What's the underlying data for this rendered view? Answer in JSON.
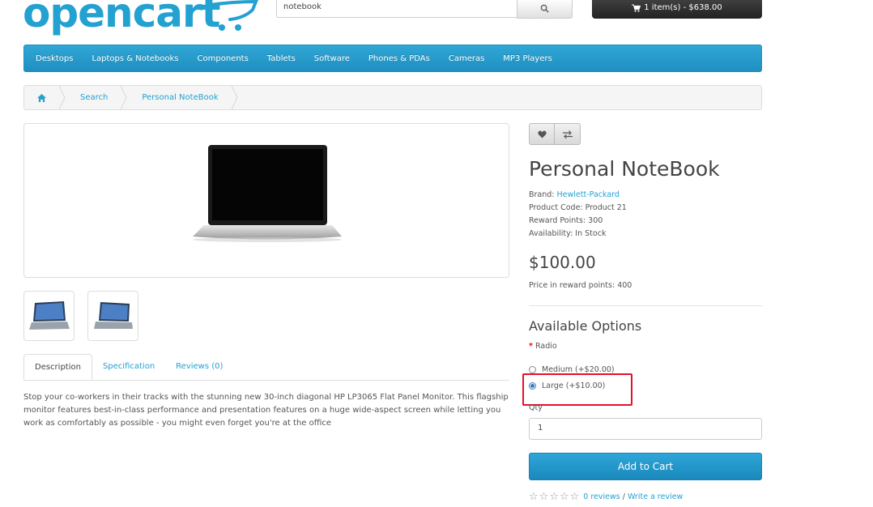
{
  "header": {
    "logo_text": "opencart",
    "search_value": "notebook",
    "cart_label": "1 item(s) - $638.00"
  },
  "menu": [
    "Desktops",
    "Laptops & Notebooks",
    "Components",
    "Tablets",
    "Software",
    "Phones & PDAs",
    "Cameras",
    "MP3 Players"
  ],
  "breadcrumb": [
    "Search",
    "Personal NoteBook"
  ],
  "tabs": [
    "Description",
    "Specification",
    "Reviews (0)"
  ],
  "description": "Stop your co-workers in their tracks with the stunning new 30-inch diagonal HP LP3065 Flat Panel Monitor. This flagship monitor features best-in-class performance and presentation features on a huge wide-aspect screen while letting you work as comfortably as possible - you might even forget you're at the office",
  "product": {
    "title": "Personal NoteBook",
    "brand_label": "Brand:",
    "brand": "Hewlett-Packard",
    "code": "Product Code: Product 21",
    "reward": "Reward Points: 300",
    "availability": "Availability: In Stock",
    "price": "$100.00",
    "points_price": "Price in reward points: 400"
  },
  "options": {
    "title": "Available Options",
    "label": "Radio",
    "radios": [
      {
        "label": "Medium (+$20.00)",
        "checked": false
      },
      {
        "label": "Large (+$10.00)",
        "checked": true
      }
    ],
    "qty_label": "Qty",
    "qty_value": "1",
    "add_to_cart": "Add to Cart"
  },
  "reviews": {
    "stars": 0,
    "count_link": "0 reviews",
    "separator": " / ",
    "write_link": "Write a review"
  },
  "colors": {
    "accent": "#23a1d1",
    "highlight": "#e5102a"
  }
}
